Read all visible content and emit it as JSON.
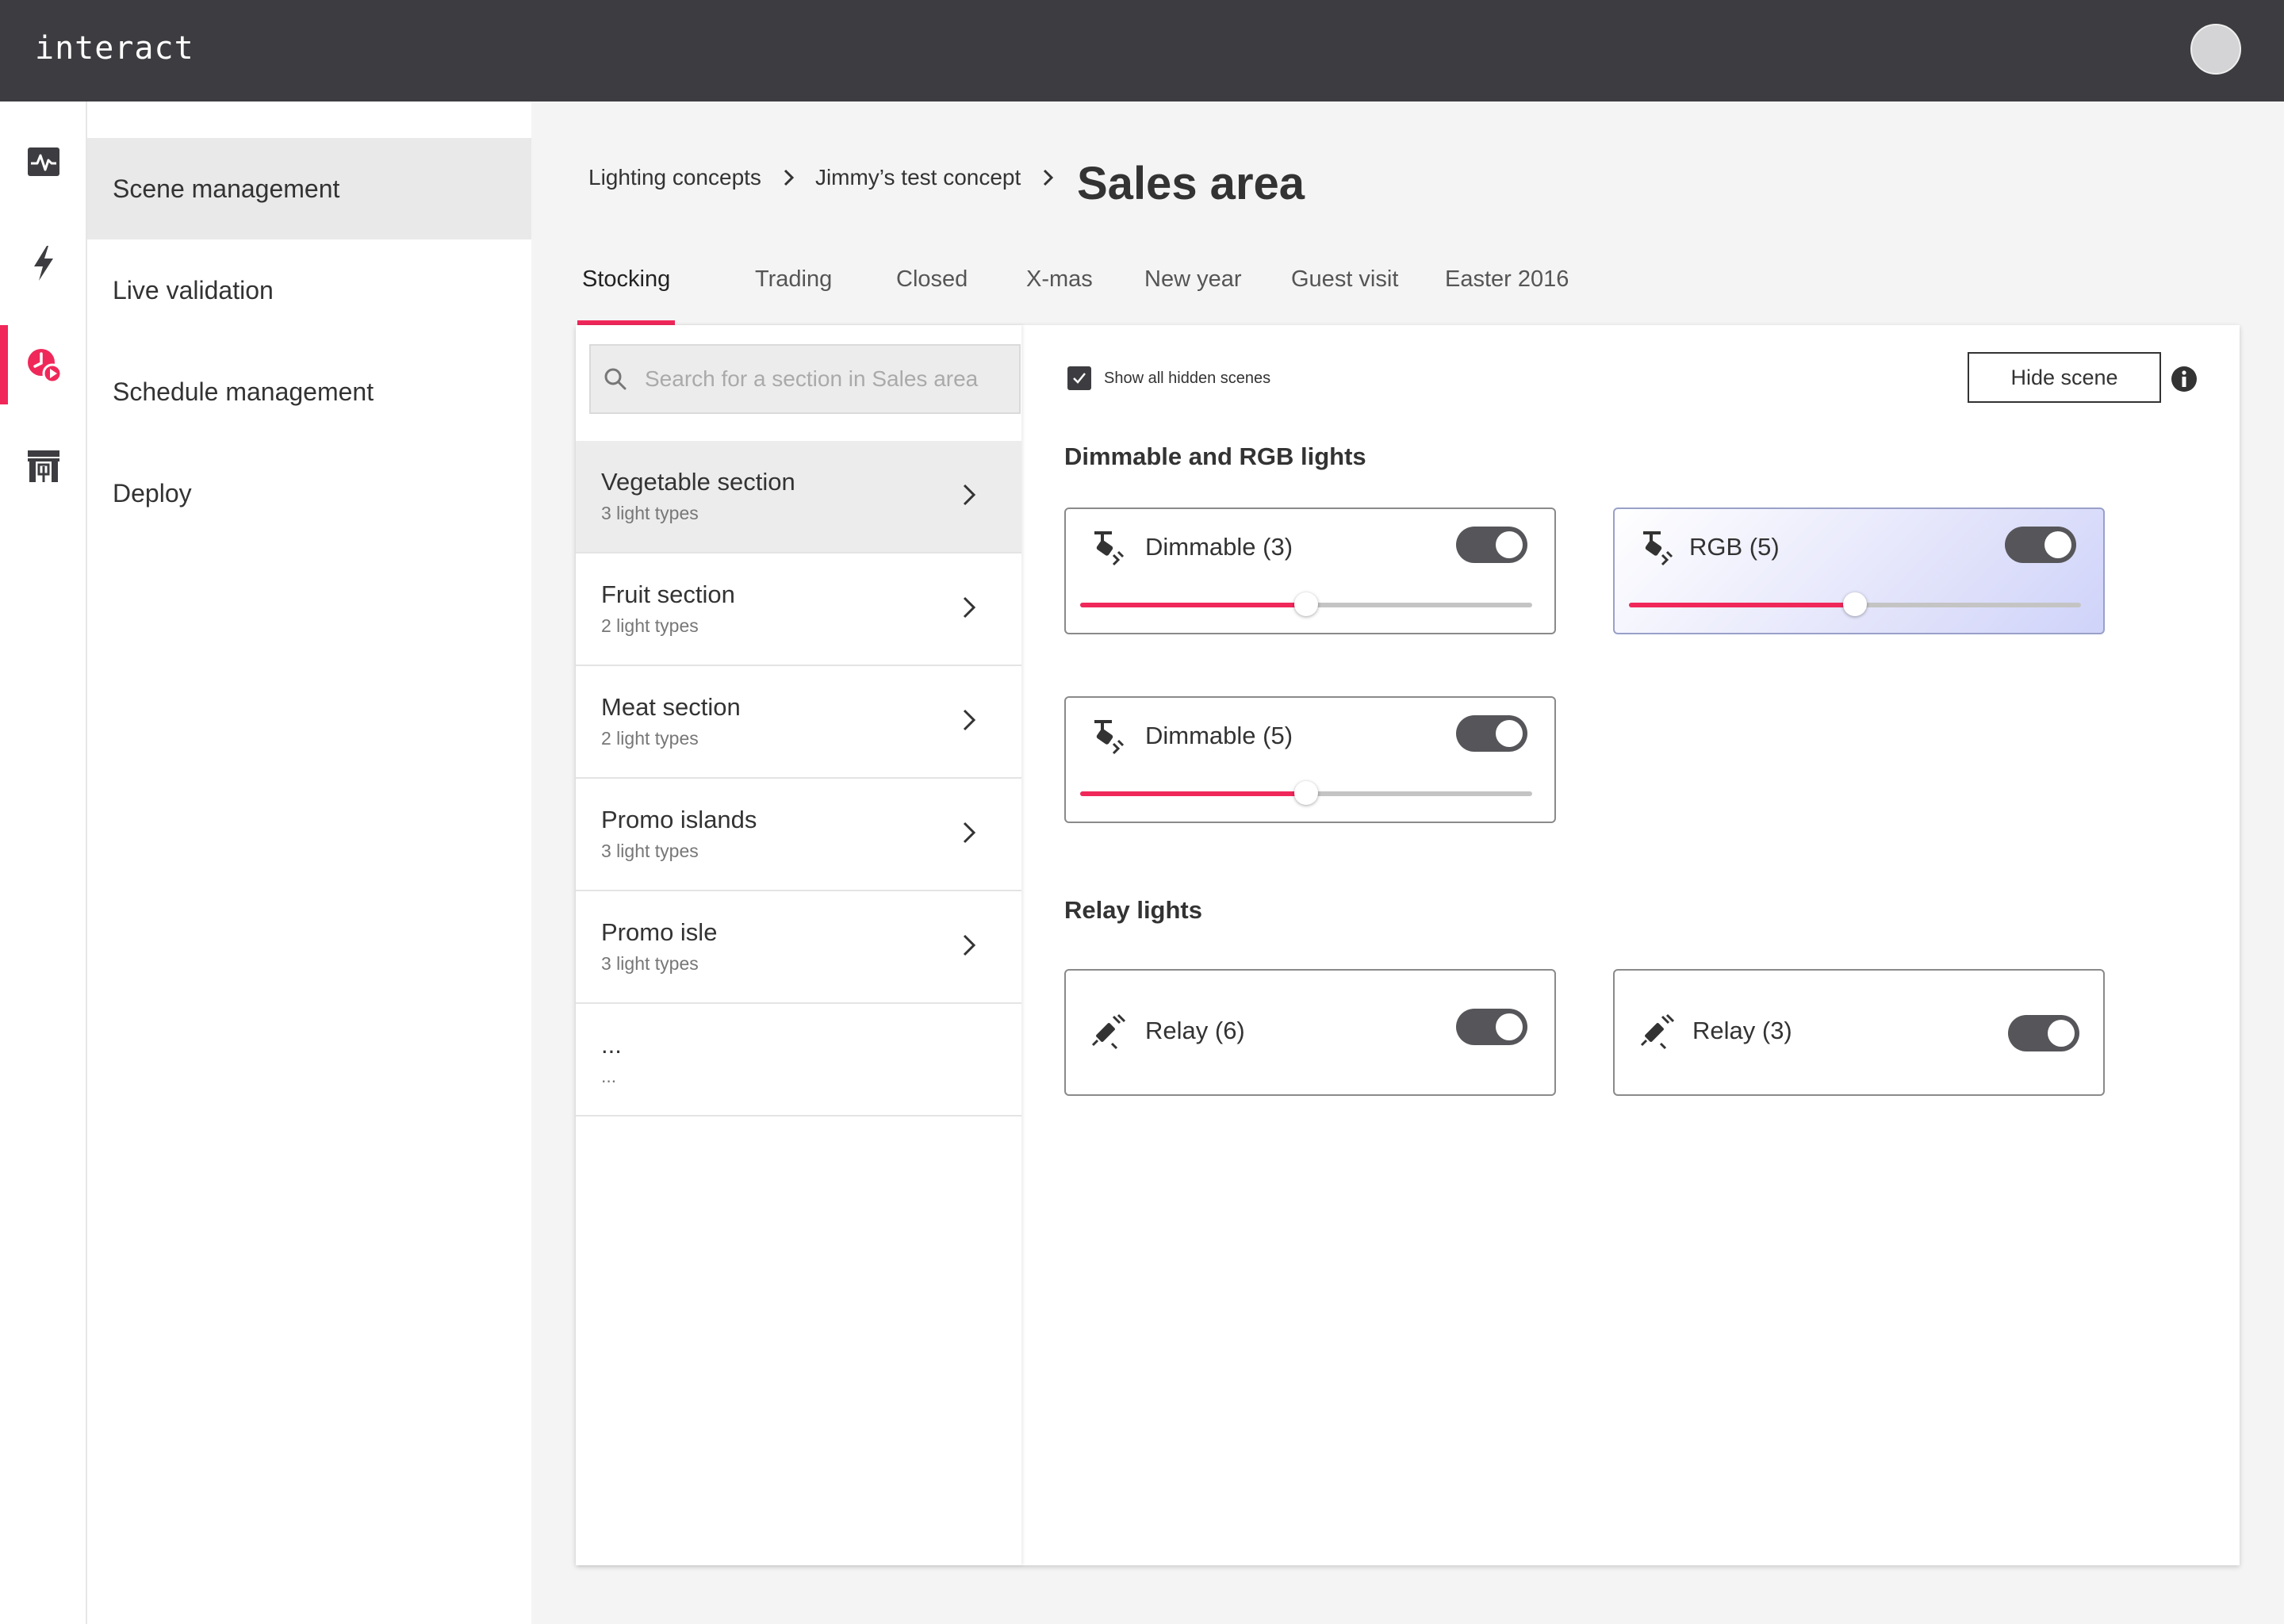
{
  "app": {
    "logo": "interact"
  },
  "nav": {
    "items": [
      {
        "label": "Scene management",
        "icon": "activity-icon",
        "active": true
      },
      {
        "label": "Live validation",
        "icon": "lightning-icon",
        "active": false
      },
      {
        "label": "Schedule management",
        "icon": "schedule-clock-icon",
        "active": false
      },
      {
        "label": "Deploy",
        "icon": "deploy-icon",
        "active": false
      }
    ]
  },
  "breadcrumb": {
    "items": [
      "Lighting concepts",
      "Jimmy’s test concept"
    ],
    "current": "Sales area"
  },
  "tabs": [
    {
      "label": "Stocking",
      "active": true
    },
    {
      "label": "Trading"
    },
    {
      "label": "Closed"
    },
    {
      "label": "X-mas"
    },
    {
      "label": "New year"
    },
    {
      "label": "Guest visit"
    },
    {
      "label": "Easter 2016"
    }
  ],
  "search": {
    "placeholder": "Search for a section in Sales area",
    "value": ""
  },
  "sections": [
    {
      "name": "Vegetable section",
      "sub": "3 light types",
      "active": true
    },
    {
      "name": "Fruit section",
      "sub": "2 light types"
    },
    {
      "name": "Meat section",
      "sub": "2 light types"
    },
    {
      "name": "Promo islands",
      "sub": "3 light types"
    },
    {
      "name": "Promo isle",
      "sub": "3 light types"
    },
    {
      "name": "...",
      "sub": "..."
    }
  ],
  "controls": {
    "show_hidden_label": "Show all hidden scenes",
    "show_hidden_checked": true,
    "hide_scene_label": "Hide scene"
  },
  "groups": {
    "dimmable_rgb": {
      "title": "Dimmable and RGB lights",
      "cards": [
        {
          "label": "Dimmable (3)",
          "on": true,
          "level": 0.5
        },
        {
          "label": "RGB (5)",
          "on": true,
          "level": 0.5
        },
        {
          "label": "Dimmable (5)",
          "on": true,
          "level": 0.5
        }
      ]
    },
    "relay": {
      "title": "Relay lights",
      "cards": [
        {
          "label": "Relay (6)",
          "on": true
        },
        {
          "label": "Relay (3)",
          "on": true
        }
      ]
    }
  },
  "colors": {
    "accent": "#f0285a",
    "topbar": "#3d3d41",
    "toggle": "#56565a"
  }
}
